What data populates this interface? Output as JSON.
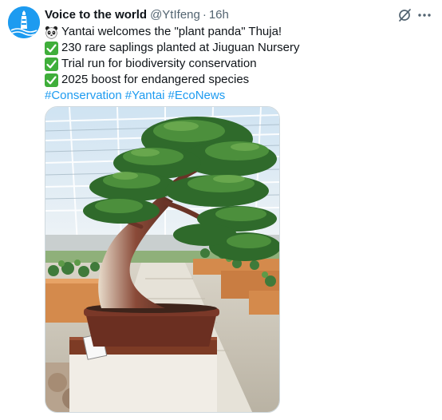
{
  "tweet": {
    "author_name": "Voice to the world",
    "handle": "@YtIfeng",
    "separator": "·",
    "time": "16h",
    "lines": [
      {
        "emoji": "panda-icon",
        "text": "Yantai welcomes the \"plant panda\" Thuja!"
      },
      {
        "emoji": "check-mark-icon",
        "text": "230 rare saplings planted at Jiuguan Nursery"
      },
      {
        "emoji": "check-mark-icon",
        "text": "Trial run for biodiversity conservation"
      },
      {
        "emoji": "check-mark-icon",
        "text": "2025 boost for endangered species"
      }
    ],
    "hashtags": [
      "#Conservation",
      "#Yantai",
      "#EcoNews"
    ]
  },
  "icons": {
    "avatar": "lighthouse-icon",
    "grok": "grok-icon",
    "more": "more-icon"
  },
  "colors": {
    "link": "#1d9bf0",
    "text": "#0f1419",
    "secondary": "#536471",
    "avatar_bg": "#1d9bf0",
    "check_bg": "#3fae3a"
  }
}
